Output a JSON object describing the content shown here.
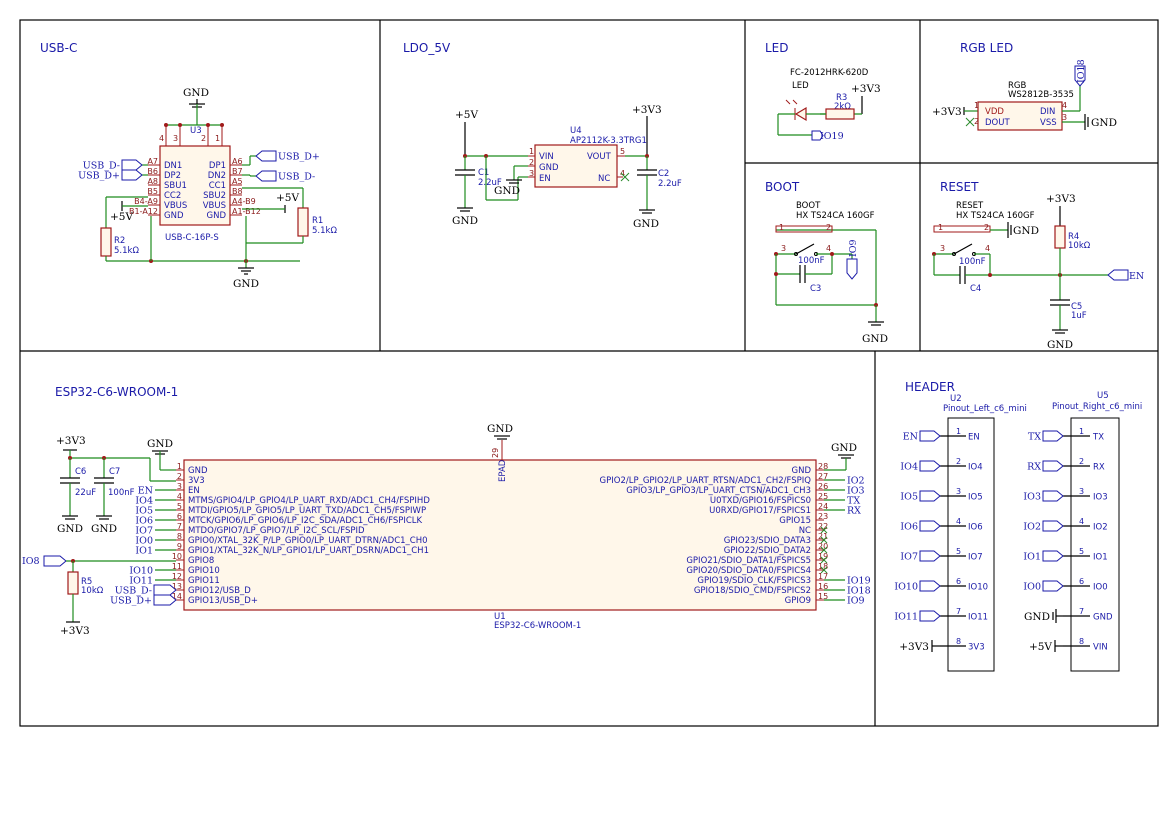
{
  "sections": {
    "usb_c": "USB-C",
    "ldo": "LDO_5V",
    "led": "LED",
    "rgb": "RGB LED",
    "boot": "BOOT",
    "reset": "RESET",
    "esp": "ESP32-C6-WROOM-1",
    "header": "HEADER"
  },
  "power": {
    "gnd": "GND",
    "v5": "+5V",
    "v33": "+3V3"
  },
  "usb": {
    "ref": "U3",
    "value": "USB-C-16P-S",
    "left_pins": [
      {
        "num": "A7",
        "name": "DN1",
        "net": "USB_D-"
      },
      {
        "num": "B6",
        "name": "DP2",
        "net": "USB_D+"
      },
      {
        "num": "A8",
        "name": "SBU1",
        "net": ""
      },
      {
        "num": "B5",
        "name": "CC2",
        "net": ""
      },
      {
        "num": "B4-A9",
        "name": "VBUS",
        "net": ""
      },
      {
        "num": "B1-A12",
        "name": "GND",
        "net": ""
      }
    ],
    "right_pins": [
      {
        "num": "A6",
        "name": "DP1",
        "net": "USB_D+"
      },
      {
        "num": "B7",
        "name": "DN2",
        "net": "USB_D-"
      },
      {
        "num": "A5",
        "name": "CC1",
        "net": ""
      },
      {
        "num": "B8",
        "name": "SBU2",
        "net": ""
      },
      {
        "num": "A4-B9",
        "name": "VBUS",
        "net": ""
      },
      {
        "num": "A1-B12",
        "name": "GND",
        "net": ""
      }
    ],
    "top_pins": [
      "4",
      "3",
      "2",
      "1"
    ],
    "r1_ref": "R1",
    "r1_val": "5.1kΩ",
    "r2_ref": "R2",
    "r2_val": "5.1kΩ"
  },
  "ldo": {
    "ref": "U4",
    "value": "AP2112K-3.3TRG1",
    "pins": [
      {
        "num": "1",
        "name": "VIN"
      },
      {
        "num": "2",
        "name": "GND"
      },
      {
        "num": "3",
        "name": "EN"
      },
      {
        "num": "5",
        "name": "VOUT"
      },
      {
        "num": "4",
        "name": "NC"
      }
    ],
    "c1_ref": "C1",
    "c1_val": "2.2uF",
    "c2_ref": "C2",
    "c2_val": "2.2uF"
  },
  "led": {
    "part": "FC-2012HRK-620D",
    "ref": "LED",
    "r3_ref": "R3",
    "r3_val": "2kΩ",
    "net": "IO19"
  },
  "rgb": {
    "ref": "RGB",
    "value": "WS2812B-3535",
    "vdd": "VDD",
    "dout": "DOUT",
    "din": "DIN",
    "vss": "VSS",
    "p1": "1",
    "p2": "2",
    "p3": "3",
    "p4": "4",
    "net": "IO18"
  },
  "boot": {
    "ref": "BOOT",
    "value": "HX TS24CA 160GF",
    "c_ref": "C3",
    "c_val": "100nF",
    "net": "IO9",
    "p1": "1",
    "p2": "2",
    "p3": "3",
    "p4": "4"
  },
  "reset": {
    "ref": "RESET",
    "value": "HX TS24CA 160GF",
    "c4_ref": "C4",
    "c4_val": "100nF",
    "r4_ref": "R4",
    "r4_val": "10kΩ",
    "c5_ref": "C5",
    "c5_val": "1uF",
    "net": "EN",
    "p1": "1",
    "p2": "2",
    "p3": "3",
    "p4": "4"
  },
  "esp": {
    "ref": "U1",
    "value": "ESP32-C6-WROOM-1",
    "epad": "EPAD",
    "epad_num": "29",
    "left_pins": [
      {
        "num": "1",
        "name": "GND",
        "net": ""
      },
      {
        "num": "2",
        "name": "3V3",
        "net": ""
      },
      {
        "num": "3",
        "name": "EN",
        "net": "EN"
      },
      {
        "num": "4",
        "name": "MTMS/GPIO4/LP_GPIO4/LP_UART_RXD/ADC1_CH4/FSPIHD",
        "net": "IO4"
      },
      {
        "num": "5",
        "name": "MTDI/GPIO5/LP_GPIO5/LP_UART_TXD/ADC1_CH5/FSPIWP",
        "net": "IO5"
      },
      {
        "num": "6",
        "name": "MTCK/GPIO6/LP_GPIO6/LP_I2C_SDA/ADC1_CH6/FSPICLK",
        "net": "IO6"
      },
      {
        "num": "7",
        "name": "MTDO/GPIO7/LP_GPIO7/LP_I2C_SCL/FSPID",
        "net": "IO7"
      },
      {
        "num": "8",
        "name": "GPIO0/XTAL_32K_P/LP_GPIO0/LP_UART_DTRN/ADC1_CH0",
        "net": "IO0"
      },
      {
        "num": "9",
        "name": "GPIO1/XTAL_32K_N/LP_GPIO1/LP_UART_DSRN/ADC1_CH1",
        "net": "IO1"
      },
      {
        "num": "10",
        "name": "GPIO8",
        "net": ""
      },
      {
        "num": "11",
        "name": "GPIO10",
        "net": "IO10"
      },
      {
        "num": "12",
        "name": "GPIO11",
        "net": "IO11"
      },
      {
        "num": "13",
        "name": "GPIO12/USB_D",
        "net": "USB_D-"
      },
      {
        "num": "14",
        "name": "GPIO13/USB_D+",
        "net": "USB_D+"
      }
    ],
    "right_pins": [
      {
        "num": "28",
        "name": "GND",
        "net": ""
      },
      {
        "num": "27",
        "name": "GPIO2/LP_GPIO2/LP_UART_RTSN/ADC1_CH2/FSPIQ",
        "net": "IO2"
      },
      {
        "num": "26",
        "name": "GPIO3/LP_GPIO3/LP_UART_CTSN/ADC1_CH3",
        "net": "IO3"
      },
      {
        "num": "25",
        "name": "U0TXD/GPIO16/FSPICS0",
        "net": "TX"
      },
      {
        "num": "24",
        "name": "U0RXD/GPIO17/FSPICS1",
        "net": "RX"
      },
      {
        "num": "23",
        "name": "GPIO15",
        "net": ""
      },
      {
        "num": "22",
        "name": "NC",
        "net": ""
      },
      {
        "num": "21",
        "name": "GPIO23/SDIO_DATA3",
        "net": ""
      },
      {
        "num": "20",
        "name": "GPIO22/SDIO_DATA2",
        "net": ""
      },
      {
        "num": "19",
        "name": "GPIO21/SDIO_DATA1/FSPICS5",
        "net": ""
      },
      {
        "num": "18",
        "name": "GPIO20/SDIO_DATA0/FSPICS4",
        "net": ""
      },
      {
        "num": "17",
        "name": "GPIO19/SDIO_CLK/FSPICS3",
        "net": "IO19"
      },
      {
        "num": "16",
        "name": "GPIO18/SDIO_CMD/FSPICS2",
        "net": "IO18"
      },
      {
        "num": "15",
        "name": "GPIO9",
        "net": "IO9"
      }
    ],
    "c6_ref": "C6",
    "c6_val": "22uF",
    "c7_ref": "C7",
    "c7_val": "100nF",
    "r5_ref": "R5",
    "r5_val": "10kΩ",
    "io8_net": "IO8"
  },
  "header": {
    "u2_ref": "U2",
    "u2_val": "Pinout_Left_c6_mini",
    "u5_ref": "U5",
    "u5_val": "Pinout_Right_c6_mini",
    "left_pins": [
      {
        "num": "1",
        "name": "EN",
        "net": "EN"
      },
      {
        "num": "2",
        "name": "IO4",
        "net": "IO4"
      },
      {
        "num": "3",
        "name": "IO5",
        "net": "IO5"
      },
      {
        "num": "4",
        "name": "IO6",
        "net": "IO6"
      },
      {
        "num": "5",
        "name": "IO7",
        "net": "IO7"
      },
      {
        "num": "6",
        "name": "IO10",
        "net": "IO10"
      },
      {
        "num": "7",
        "name": "IO11",
        "net": "IO11"
      },
      {
        "num": "8",
        "name": "3V3",
        "net": "+3V3"
      }
    ],
    "right_pins": [
      {
        "num": "1",
        "name": "TX",
        "net": "TX"
      },
      {
        "num": "2",
        "name": "RX",
        "net": "RX"
      },
      {
        "num": "3",
        "name": "IO3",
        "net": "IO3"
      },
      {
        "num": "4",
        "name": "IO2",
        "net": "IO2"
      },
      {
        "num": "5",
        "name": "IO1",
        "net": "IO1"
      },
      {
        "num": "6",
        "name": "IO0",
        "net": "IO0"
      },
      {
        "num": "7",
        "name": "GND",
        "net": "GND"
      },
      {
        "num": "8",
        "name": "VIN",
        "net": "+5V"
      }
    ]
  }
}
